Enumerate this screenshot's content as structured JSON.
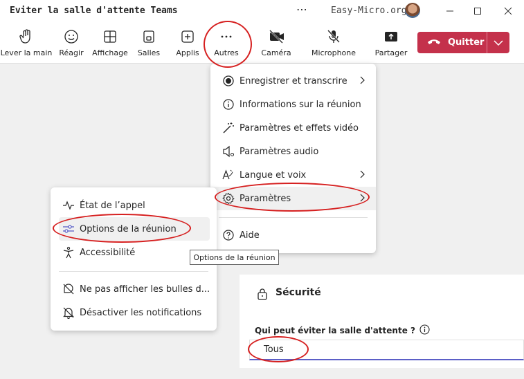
{
  "window": {
    "title": "Eviter la salle d'attente Teams",
    "more": "⋯",
    "org": "Easy-Micro.org"
  },
  "toolbar": {
    "raise_hand": "Lever la main",
    "react": "Réagir",
    "view": "Affichage",
    "rooms": "Salles",
    "apps": "Applis",
    "more": "Autres",
    "camera": "Caméra",
    "microphone": "Microphone",
    "share": "Partager",
    "leave": "Quitter"
  },
  "more_menu": {
    "items": [
      {
        "label": "Enregistrer et transcrire"
      },
      {
        "label": "Informations sur la réunion"
      },
      {
        "label": "Paramètres et effets vidéo"
      },
      {
        "label": "Paramètres audio"
      },
      {
        "label": "Langue et voix"
      },
      {
        "label": "Paramètres"
      },
      {
        "label": "Aide"
      }
    ]
  },
  "settings_menu": {
    "items": [
      {
        "label": "État de l’appel"
      },
      {
        "label": "Options de la réunion"
      },
      {
        "label": "Accessibilité"
      },
      {
        "label": "Ne pas afficher les bulles d..."
      },
      {
        "label": "Désactiver les notifications"
      }
    ]
  },
  "tooltip": "Options de la réunion",
  "security": {
    "title": "Sécurité",
    "question": "Qui peut éviter la salle d'attente ?",
    "selected": "Tous"
  },
  "colors": {
    "accent": "#5b5fc7",
    "leave": "#c4314b",
    "annotation": "#d62020"
  }
}
